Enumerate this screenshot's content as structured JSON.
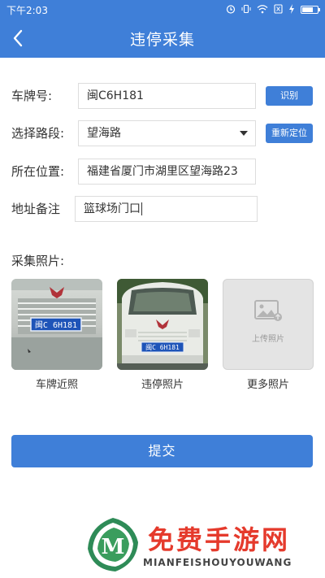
{
  "status_bar": {
    "time": "下午2:03",
    "icons": [
      "alarm-icon",
      "vibrate-icon",
      "wifi-icon",
      "sim-icon",
      "battery-icon"
    ]
  },
  "nav": {
    "title": "违停采集",
    "back_icon": "chevron-left-icon"
  },
  "form": {
    "plate": {
      "label": "车牌号:",
      "value": "闽C6H181",
      "button": "识别"
    },
    "road": {
      "label": "选择路段:",
      "value": "望海路",
      "button": "重新定位"
    },
    "location": {
      "label": "所在位置:",
      "value": "福建省厦门市湖里区望海路23"
    },
    "note": {
      "label": "地址备注",
      "value": "篮球场门口"
    }
  },
  "photos": {
    "label": "采集照片:",
    "items": [
      {
        "caption": "车牌近照",
        "plate_text": "闽C 6H181"
      },
      {
        "caption": "违停照片",
        "plate_text": "闽C 6H181"
      },
      {
        "caption": "更多照片",
        "placeholder": "上传照片"
      }
    ]
  },
  "submit": {
    "label": "提交"
  },
  "watermark": {
    "title": "免费手游网",
    "subtitle": "MIANFEISHOUYOUWANG",
    "logo_letter": "M"
  },
  "colors": {
    "primary": "#3f7fd8",
    "watermark_red": "#e53a2c",
    "watermark_green": "#2e8b57"
  }
}
